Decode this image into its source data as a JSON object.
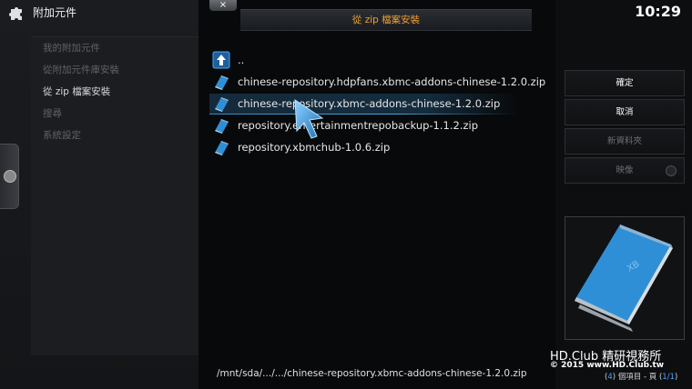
{
  "header": {
    "title": "附加元件",
    "icon": "puzzle-icon"
  },
  "sidebar": {
    "items": [
      {
        "label": "我的附加元件",
        "active": false
      },
      {
        "label": "從附加元件庫安裝",
        "active": false
      },
      {
        "label": "從 zip 檔案安裝",
        "active": true
      },
      {
        "label": "搜尋",
        "active": false
      },
      {
        "label": "系統設定",
        "active": false
      }
    ]
  },
  "dialog": {
    "close_label": "×",
    "title": "從 zip 檔案安裝",
    "files": [
      {
        "name": "..",
        "icon": "up-folder-icon"
      },
      {
        "name": "chinese-repository.hdpfans.xbmc-addons-chinese-1.2.0.zip",
        "icon": "zip-file-icon"
      },
      {
        "name": "chinese-repository.xbmc-addons-chinese-1.2.0.zip",
        "icon": "zip-file-icon",
        "selected": true
      },
      {
        "name": "repository.entertainmentrepobackup-1.1.2.zip",
        "icon": "zip-file-icon"
      },
      {
        "name": "repository.xbmchub-1.0.6.zip",
        "icon": "zip-file-icon"
      }
    ],
    "path": "/mnt/sda/.../.../chinese-repository.xbmc-addons-chinese-1.2.0.zip"
  },
  "clock": "10:29",
  "buttons": {
    "ok": "確定",
    "cancel": "取消",
    "new_folder": "新資料夾",
    "mirror": "映像"
  },
  "footer": {
    "count_prefix": "(",
    "count_value": "4",
    "count_mid": ") 個項目 - 頁 (",
    "page_value": "1/1",
    "count_suffix": ")",
    "watermark_brand": "HD.Club 精研視務所",
    "watermark_copy": "© 2015  www.HD.Club.tw"
  },
  "colors": {
    "title_orange": "#f0a030",
    "accent_blue": "#4aa6ff"
  }
}
